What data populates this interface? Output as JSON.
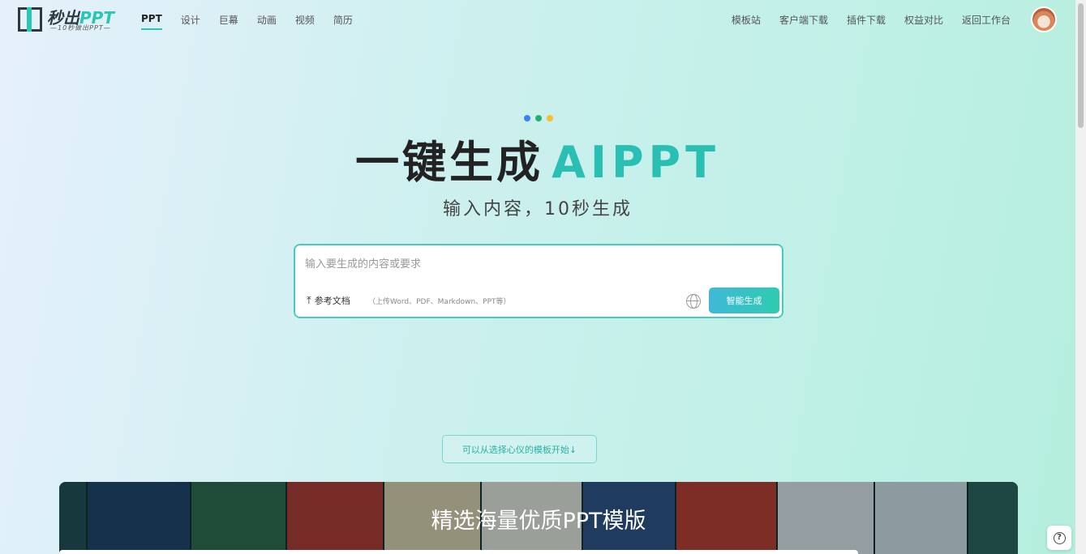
{
  "logo": {
    "text_main": "秒出",
    "text_accent": "PPT",
    "tagline": "—10秒做出PPT—"
  },
  "nav_left": [
    {
      "label": "PPT",
      "active": true
    },
    {
      "label": "设计"
    },
    {
      "label": "巨幕"
    },
    {
      "label": "动画"
    },
    {
      "label": "视频"
    },
    {
      "label": "简历"
    }
  ],
  "nav_right": [
    {
      "label": "模板站"
    },
    {
      "label": "客户端下载"
    },
    {
      "label": "插件下载"
    },
    {
      "label": "权益对比"
    },
    {
      "label": "返回工作台"
    }
  ],
  "hero": {
    "title_main": "一键生成",
    "title_accent": "AIPPT",
    "subtitle": "输入内容，10秒生成",
    "dot_colors": [
      "#3b82f6",
      "#22b36b",
      "#f5c02b"
    ]
  },
  "prompt": {
    "placeholder": "输入要生成的内容或要求",
    "value": "",
    "upload_label": "参考文档",
    "upload_hint": "（上传Word、PDF、Markdown、PPT等）",
    "generate_label": "智能生成"
  },
  "template_hint": "可以从选择心仪的模板开始↓",
  "gallery": {
    "title": "精选海量优质PPT模版",
    "thumb_colors": [
      "#1f4a52",
      "#1d3e6a",
      "#2a6a4a",
      "#b6352c",
      "#e9d8b5",
      "#f2efe6",
      "#2d4f86",
      "#c6382d",
      "#e8eef4",
      "#dbe8f1",
      "#2b5f5a"
    ]
  },
  "colors": {
    "accent": "#29c0b3",
    "button_gradient_start": "#3fb8d8",
    "button_gradient_end": "#2fcbb0"
  }
}
